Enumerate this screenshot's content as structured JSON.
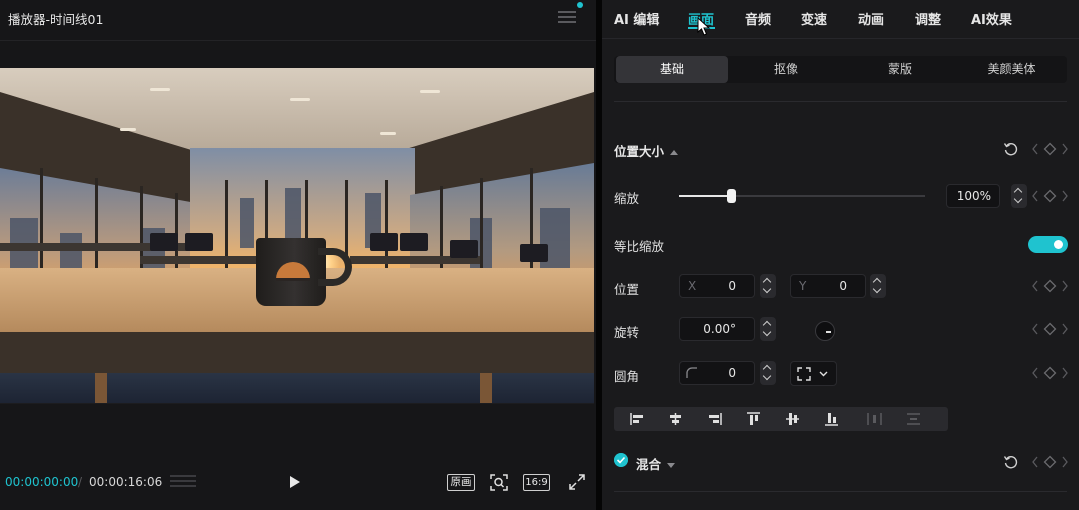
{
  "player": {
    "title": "播放器-时间线01",
    "time_current": "00:00:00:00",
    "time_separator": "/",
    "time_total": "00:00:16:06",
    "btn_original": "原画",
    "btn_ratio": "16:9",
    "accent": "#1fc3cf"
  },
  "panel": {
    "top_tabs": [
      {
        "label": "AI 编辑"
      },
      {
        "label": "画面"
      },
      {
        "label": "音频"
      },
      {
        "label": "变速"
      },
      {
        "label": "动画"
      },
      {
        "label": "调整"
      },
      {
        "label": "AI效果"
      }
    ],
    "active_top_tab": "画面",
    "sub_tabs": [
      {
        "label": "基础"
      },
      {
        "label": "抠像"
      },
      {
        "label": "蒙版"
      },
      {
        "label": "美颜美体"
      }
    ],
    "active_sub_tab": "基础",
    "position_size": {
      "title": "位置大小",
      "scale": {
        "label": "缩放",
        "value": "100%",
        "slider_fraction": 0.21
      },
      "uniform_scale": {
        "label": "等比缩放",
        "enabled": true
      },
      "position": {
        "label": "位置",
        "x_prefix": "X",
        "x": "0",
        "y_prefix": "Y",
        "y": "0"
      },
      "rotation": {
        "label": "旋转",
        "value": "0.00°"
      },
      "corner": {
        "label": "圆角",
        "value": "0"
      }
    },
    "blend": {
      "title": "混合",
      "checked": true
    },
    "icons": [
      "reset-icon",
      "keyframe-prev-icon",
      "keyframe-diamond-icon",
      "keyframe-next-icon",
      "play-icon",
      "fullscreen-icon",
      "focus-icon",
      "menu-icon"
    ]
  }
}
